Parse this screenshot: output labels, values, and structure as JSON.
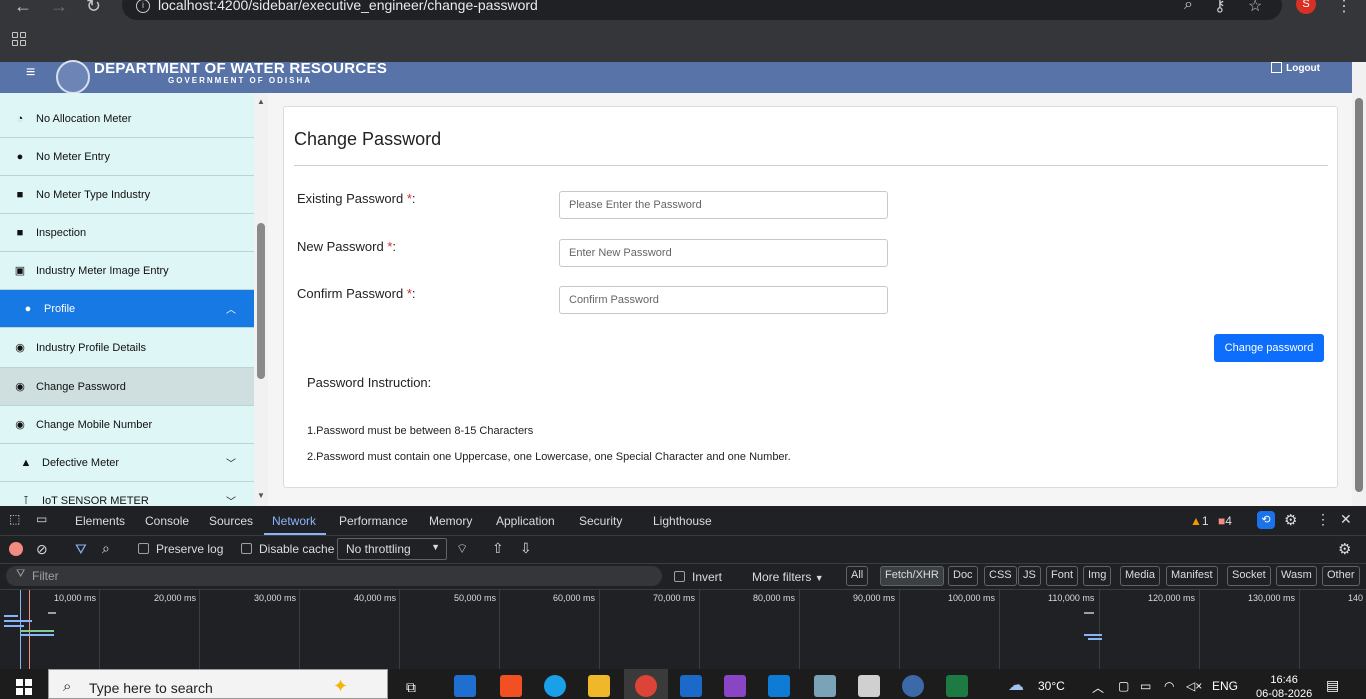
{
  "browser": {
    "url": "localhost:4200/sidebar/executive_engineer/change-password",
    "profile_initial": "S"
  },
  "header": {
    "title": "DEPARTMENT OF WATER RESOURCES",
    "subtitle": "GOVERNMENT OF ODISHA",
    "logout_label": "Logout"
  },
  "sidebar": {
    "items": [
      {
        "label": "No Allocation Meter",
        "icon": "gauge-icon"
      },
      {
        "label": "No Meter Entry",
        "icon": "alert-circle-icon"
      },
      {
        "label": "No Meter Type Industry",
        "icon": "briefcase-icon"
      },
      {
        "label": "Inspection",
        "icon": "briefcase-icon"
      },
      {
        "label": "Industry Meter Image Entry",
        "icon": "image-add-icon"
      },
      {
        "label": "Profile",
        "icon": "person-icon"
      },
      {
        "label": "Industry Profile Details",
        "icon": "user-circle-icon"
      },
      {
        "label": "Change Password",
        "icon": "user-circle-icon"
      },
      {
        "label": "Change Mobile Number",
        "icon": "user-circle-icon"
      },
      {
        "label": "Defective Meter",
        "icon": "warning-icon"
      },
      {
        "label": "IoT SENSOR METER",
        "icon": "sensor-icon"
      }
    ]
  },
  "form": {
    "title": "Change Password",
    "existing_label": "Existing Password",
    "existing_placeholder": "Please Enter the Password",
    "new_label": "New Password",
    "new_placeholder": "Enter New Password",
    "confirm_label": "Confirm Password",
    "confirm_placeholder": "Confirm Password",
    "required_mark": "*",
    "colon": ":",
    "submit_label": "Change password",
    "instruction_title": "Password Instruction:",
    "instructions": [
      "1.Password must be between 8-15 Characters",
      "2.Password must contain one Uppercase, one Lowercase, one Special Character and one Number."
    ]
  },
  "devtools": {
    "tabs": [
      "Elements",
      "Console",
      "Sources",
      "Network",
      "Performance",
      "Memory",
      "Application",
      "Security",
      "Lighthouse"
    ],
    "active_tab": "Network",
    "warnings": "1",
    "errors": "4",
    "preserve_log": "Preserve log",
    "disable_cache": "Disable cache",
    "throttling": "No throttling",
    "filter_placeholder": "Filter",
    "invert": "Invert",
    "more_filters": "More filters",
    "types": [
      "All",
      "Fetch/XHR",
      "Doc",
      "CSS",
      "JS",
      "Font",
      "Img",
      "Media",
      "Manifest",
      "Socket",
      "Wasm",
      "Other"
    ],
    "timeline_ticks": [
      "10,000 ms",
      "20,000 ms",
      "30,000 ms",
      "40,000 ms",
      "50,000 ms",
      "60,000 ms",
      "70,000 ms",
      "80,000 ms",
      "90,000 ms",
      "100,000 ms",
      "110,000 ms",
      "120,000 ms",
      "130,000 ms",
      "140"
    ]
  },
  "taskbar": {
    "search_placeholder": "Type here to search",
    "temperature": "30°C",
    "language": "ENG",
    "time": "16:46",
    "date": "06-08-2026"
  }
}
